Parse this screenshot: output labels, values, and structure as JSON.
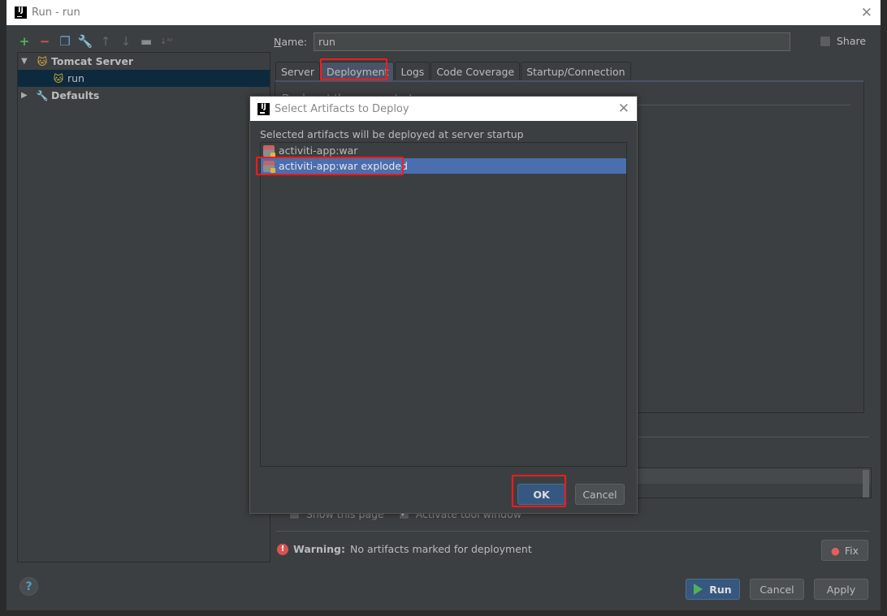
{
  "window": {
    "title": "Run - run",
    "logo": "IJ",
    "close_icon": "✕"
  },
  "toolbar": {
    "icons": [
      {
        "name": "add-icon",
        "glyph": "+",
        "color": "#4db359"
      },
      {
        "name": "remove-icon",
        "glyph": "−",
        "color": "#d9534f"
      },
      {
        "name": "copy-icon",
        "glyph": "❐",
        "color": "#6a9fd4"
      },
      {
        "name": "wrench-icon",
        "glyph": "🔧",
        "color": "#c9a050"
      },
      {
        "name": "move-up-icon",
        "glyph": "↑",
        "color": "#666"
      },
      {
        "name": "move-down-icon",
        "glyph": "↓",
        "color": "#666"
      },
      {
        "name": "folder-icon",
        "glyph": "▬",
        "color": "#8a8e92"
      },
      {
        "name": "sort-icon",
        "glyph": "↓ᵃᶻ",
        "color": "#666"
      }
    ]
  },
  "tree": {
    "items": [
      {
        "label": "Tomcat Server",
        "expanded": true,
        "bold": true,
        "icon": "tomcat-icon"
      },
      {
        "label": "run",
        "child": true,
        "selected": true,
        "icon": "tomcat-run-icon"
      },
      {
        "label": "Defaults",
        "expanded": false,
        "bold": true,
        "icon": "wrench-icon"
      }
    ]
  },
  "form": {
    "name_label": "Name:",
    "name_value": "run",
    "share_label": "Share",
    "share_checked": false
  },
  "tabs": [
    {
      "label": "Server",
      "active": false
    },
    {
      "label": "Deployment",
      "active": true
    },
    {
      "label": "Logs",
      "active": false
    },
    {
      "label": "Code Coverage",
      "active": false
    },
    {
      "label": "Startup/Connection",
      "active": false
    }
  ],
  "deployment": {
    "header_text": "Deploy at the server startup"
  },
  "options": {
    "show_page_label": "Show this page",
    "show_page_checked": false,
    "activate_label": "Activate tool window",
    "activate_checked": true
  },
  "warning": {
    "title": "Warning:",
    "message": "No artifacts marked for deployment",
    "fix_label": "Fix"
  },
  "buttons": {
    "help": "?",
    "run": "Run",
    "cancel": "Cancel",
    "apply": "Apply"
  },
  "modal": {
    "title": "Select Artifacts to Deploy",
    "description": "Selected artifacts will be deployed at server startup",
    "artifacts": [
      {
        "label": "activiti-app:war",
        "selected": false
      },
      {
        "label": "activiti-app:war exploded",
        "selected": true
      }
    ],
    "ok_label": "OK",
    "cancel_label": "Cancel"
  },
  "colors": {
    "background": "#3c3f41",
    "selection": "#4b6eaf",
    "primary_button": "#365880",
    "highlight_annotation": "#ff1a1a"
  }
}
